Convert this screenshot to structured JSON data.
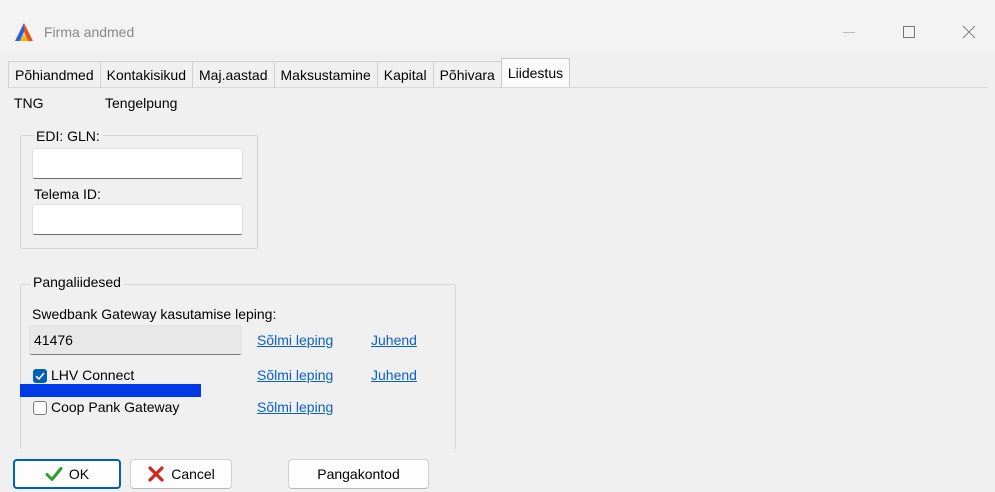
{
  "window": {
    "title": "Firma andmed"
  },
  "tabs": [
    {
      "label": "Põhiandmed",
      "active": false
    },
    {
      "label": "Kontakisikud",
      "active": false
    },
    {
      "label": "Maj.aastad",
      "active": false
    },
    {
      "label": "Maksustamine",
      "active": false
    },
    {
      "label": "Kapital",
      "active": false
    },
    {
      "label": "Põhivara",
      "active": false
    },
    {
      "label": "Liidestus",
      "active": true
    }
  ],
  "company": {
    "code": "TNG",
    "name": "Tengelpung"
  },
  "edi_group": {
    "gln_label": "EDI: GLN:",
    "gln_value": "",
    "telema_label": "Telema ID:",
    "telema_value": ""
  },
  "bank_group": {
    "title": "Pangaliidesed",
    "swedbank_label": "Swedbank Gateway kasutamise leping:",
    "swedbank_value": "41476",
    "swedbank_sign": "Sõlmi leping",
    "swedbank_guide": "Juhend",
    "lhv_label": "LHV Connect",
    "lhv_checked": true,
    "lhv_sign": "Sõlmi leping",
    "lhv_guide": "Juhend",
    "coop_label": "Coop Pank Gateway",
    "coop_checked": false,
    "coop_sign": "Sõlmi leping"
  },
  "buttons": {
    "ok": "OK",
    "cancel": "Cancel",
    "bank_accounts": "Pangakontod"
  },
  "colors": {
    "accent": "#005fb8",
    "link": "#0a60c9",
    "redaction": "#0039e6"
  },
  "icons": {
    "app": "app-logo-icon",
    "ok": "check-icon",
    "cancel": "x-icon"
  }
}
